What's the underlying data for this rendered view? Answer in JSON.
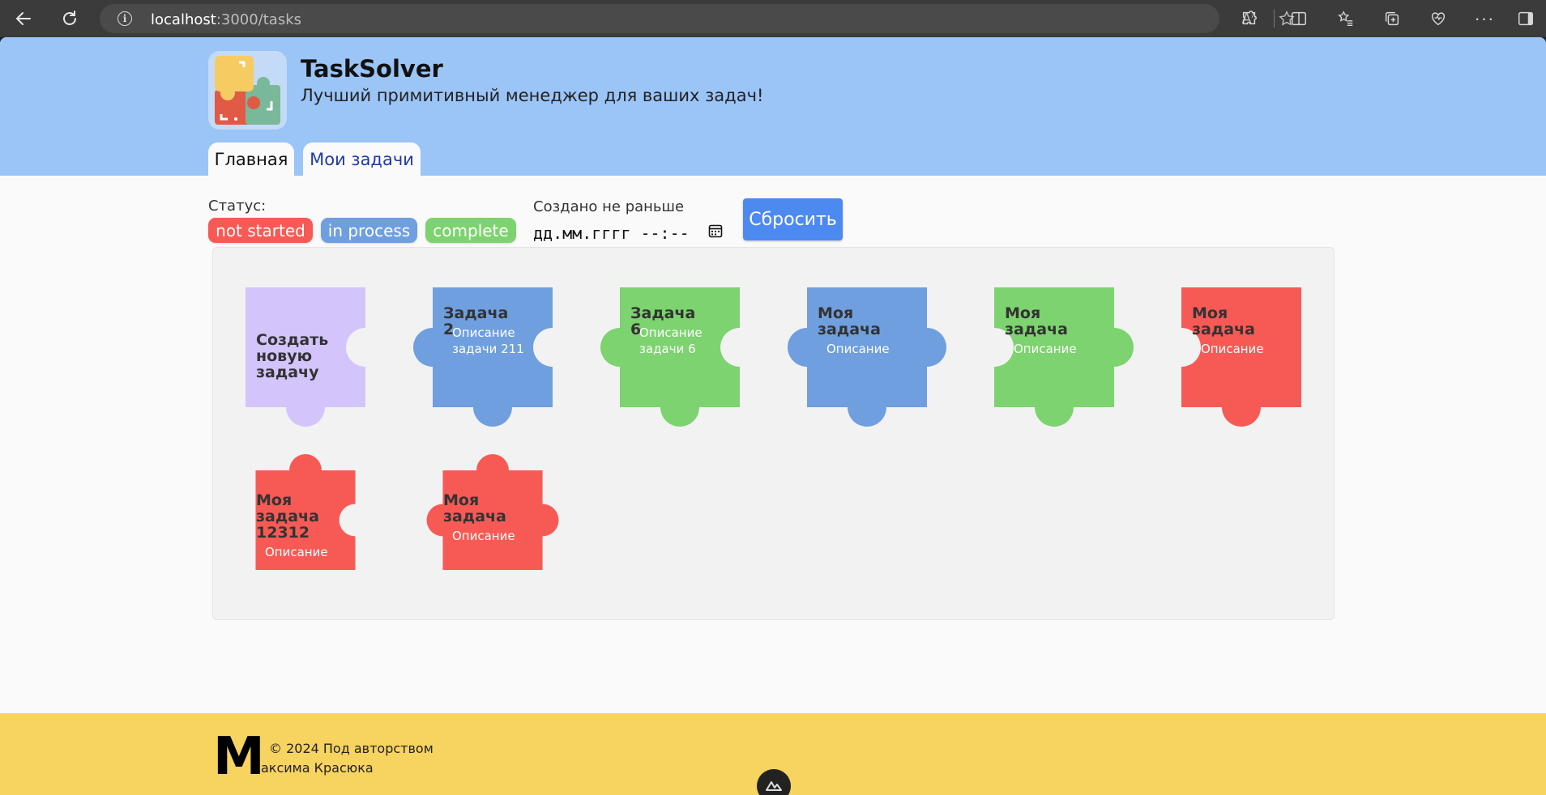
{
  "browser": {
    "url_host": "localhost",
    "url_path": ":3000/tasks"
  },
  "header": {
    "app_title": "TaskSolver",
    "app_subtitle": "Лучший примитивный менеджер для ваших задач!",
    "tabs": [
      {
        "label": "Главная"
      },
      {
        "label": "Мои задачи"
      }
    ]
  },
  "filters": {
    "status_label": "Статус:",
    "statuses": [
      {
        "label": "not started",
        "color": "#f75a55"
      },
      {
        "label": "in process",
        "color": "#6f9fde"
      },
      {
        "label": "complete",
        "color": "#7dd36f"
      }
    ],
    "date_label": "Создано не раньше",
    "date_placeholder": "дд.мм.гггг --:--",
    "reset_label": "Сбросить"
  },
  "tasks": [
    {
      "title": "Создать новую задачу",
      "description": "",
      "color": "#d4c4fc"
    },
    {
      "title": "Задача 2",
      "description": "Описание задачи 211",
      "color": "#6f9fde"
    },
    {
      "title": "Задача 6",
      "description": "Описание задачи 6",
      "color": "#7dd36f"
    },
    {
      "title": "Моя задача",
      "description": "Описание",
      "color": "#6f9fde"
    },
    {
      "title": "Моя задача",
      "description": "Описание",
      "color": "#7dd36f"
    },
    {
      "title": "Моя задача",
      "description": "Описание",
      "color": "#f75a55"
    },
    {
      "title": "Моя задача 12312",
      "description": "Описание",
      "color": "#f75a55"
    },
    {
      "title": "Моя задача",
      "description": "Описание",
      "color": "#f75a55"
    }
  ],
  "footer": {
    "logo_letter": "М",
    "line1": "© 2024 Под авторством",
    "line2": "аксима Красюка"
  }
}
